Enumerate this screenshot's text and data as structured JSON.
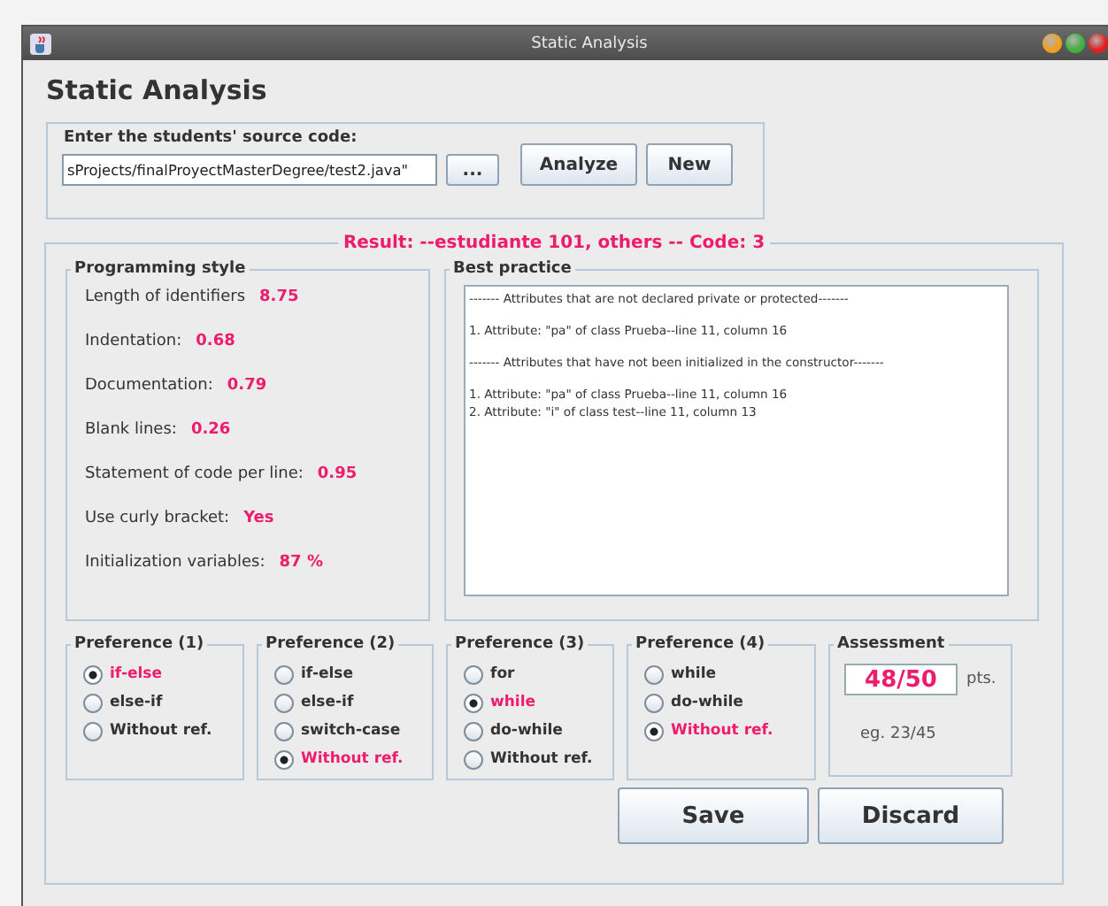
{
  "window": {
    "title": "Static Analysis"
  },
  "heading": "Static Analysis",
  "source": {
    "label": "Enter the students' source code:",
    "path": "sProjects/finalProyectMasterDegree/test2.java\"",
    "browse": "...",
    "buttons": [
      "Analyze",
      "New"
    ]
  },
  "result": "Result: --estudiante 101, others -- Code: 3",
  "style": {
    "title": "Programming style",
    "metrics": [
      {
        "label": "Length of identifiers",
        "value": "8.75"
      },
      {
        "label": "Indentation:",
        "value": "0.68"
      },
      {
        "label": "Documentation:",
        "value": "0.79"
      },
      {
        "label": "Blank lines:",
        "value": "0.26"
      },
      {
        "label": "Statement of code per line:",
        "value": "0.95"
      },
      {
        "label": "Use curly bracket:",
        "value": "Yes"
      },
      {
        "label": "Initialization variables:",
        "value": "87 %"
      }
    ]
  },
  "best_practice": {
    "title": "Best practice",
    "sections": [
      {
        "heading": "------- Attributes that are not declared private or protected-------",
        "items": [
          "1. Attribute: \"pa\" of class Prueba--line 11, column 16"
        ]
      },
      {
        "heading": "------- Attributes that have not been initialized in the constructor-------",
        "items": [
          "1. Attribute: \"pa\" of class Prueba--line 11, column 16",
          "2. Attribute: \"i\" of class test--line 11, column 13"
        ]
      }
    ]
  },
  "preferences": [
    {
      "title": "Preference (1)",
      "options": [
        {
          "label": "if-else",
          "selected": true
        },
        {
          "label": "else-if",
          "selected": false
        },
        {
          "label": "Without ref.",
          "selected": false
        }
      ]
    },
    {
      "title": "Preference (2)",
      "options": [
        {
          "label": "if-else",
          "selected": false
        },
        {
          "label": "else-if",
          "selected": false
        },
        {
          "label": "switch-case",
          "selected": false
        },
        {
          "label": "Without ref.",
          "selected": true
        }
      ]
    },
    {
      "title": "Preference (3)",
      "options": [
        {
          "label": "for",
          "selected": false
        },
        {
          "label": "while",
          "selected": true
        },
        {
          "label": "do-while",
          "selected": false
        },
        {
          "label": "Without ref.",
          "selected": false
        }
      ]
    },
    {
      "title": "Preference (4)",
      "options": [
        {
          "label": "while",
          "selected": false
        },
        {
          "label": "do-while",
          "selected": false
        },
        {
          "label": "Without ref.",
          "selected": true
        }
      ]
    }
  ],
  "assessment": {
    "title": "Assessment",
    "value": "48/50",
    "unit": "pts.",
    "hint": "eg. 23/45"
  },
  "buttons": [
    "Save",
    "Discard"
  ]
}
